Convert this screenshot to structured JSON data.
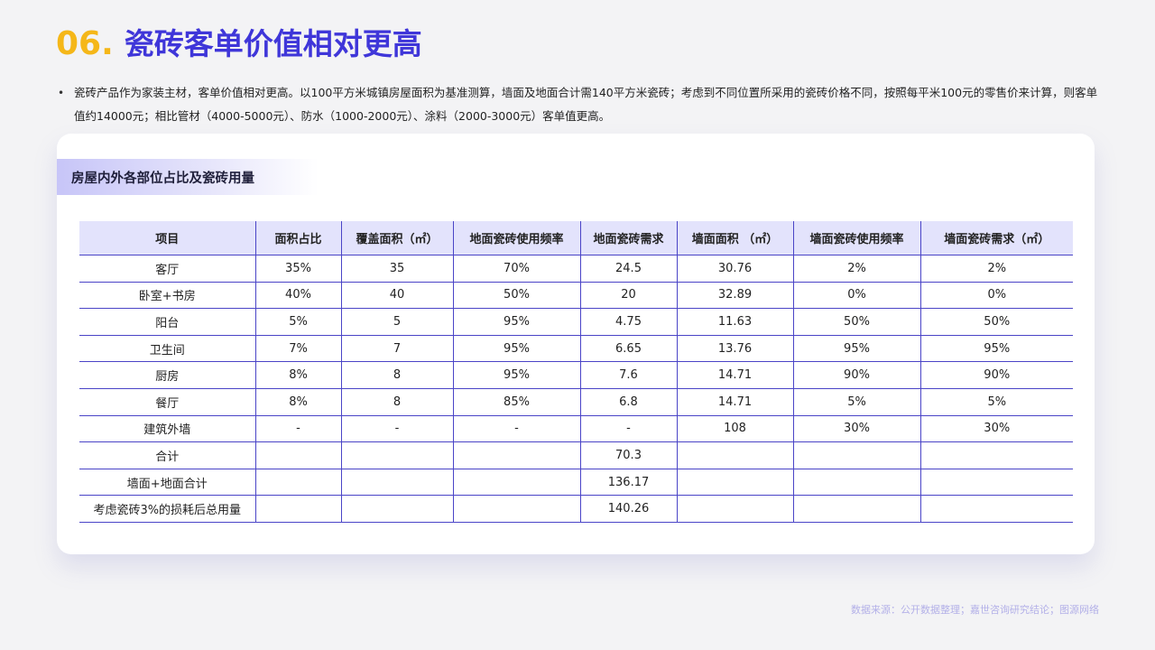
{
  "header": {
    "number": "06.",
    "title": "瓷砖客单价值相对更高"
  },
  "bullet": {
    "dot": "•",
    "text": "瓷砖产品作为家装主材，客单价值相对更高。以100平方米城镇房屋面积为基准测算，墙面及地面合计需140平方米瓷砖；考虑到不同位置所采用的瓷砖价格不同，按照每平米100元的零售价来计算，则客单值约14000元；相比管材（4000-5000元）、防水（1000-2000元）、涂料（2000-3000元）客单值更高。"
  },
  "section": {
    "label": "房屋内外各部位占比及瓷砖用量"
  },
  "table": {
    "headers": [
      "项目",
      "面积占比",
      "覆盖面积（㎡）",
      "地面瓷砖使用频率",
      "地面瓷砖需求",
      "墙面面积 （㎡）",
      "墙面瓷砖使用频率",
      "墙面瓷砖需求（㎡）"
    ],
    "rows": [
      [
        "客厅",
        "35%",
        "35",
        "70%",
        "24.5",
        "30.76",
        "2%",
        "2%"
      ],
      [
        "卧室+书房",
        "40%",
        "40",
        "50%",
        "20",
        "32.89",
        "0%",
        "0%"
      ],
      [
        "阳台",
        "5%",
        "5",
        "95%",
        "4.75",
        "11.63",
        "50%",
        "50%"
      ],
      [
        "卫生间",
        "7%",
        "7",
        "95%",
        "6.65",
        "13.76",
        "95%",
        "95%"
      ],
      [
        "厨房",
        "8%",
        "8",
        "95%",
        "7.6",
        "14.71",
        "90%",
        "90%"
      ],
      [
        "餐厅",
        "8%",
        "8",
        "85%",
        "6.8",
        "14.71",
        "5%",
        "5%"
      ],
      [
        "建筑外墙",
        "-",
        "-",
        "-",
        "-",
        "108",
        "30%",
        "30%"
      ],
      [
        "合计",
        "",
        "",
        "",
        "70.3",
        "",
        "",
        ""
      ],
      [
        "墙面+地面合计",
        "",
        "",
        "",
        "136.17",
        "",
        "",
        ""
      ],
      [
        "考虑瓷砖3%的损耗后总用量",
        "",
        "",
        "",
        "140.26",
        "",
        "",
        ""
      ]
    ]
  },
  "footer": {
    "source": "数据来源：公开数据整理；嘉世咨询研究结论；图源网络"
  },
  "colors": {
    "accent_yellow": "#f5b719",
    "accent_blue": "#3f36d9",
    "table_header_bg": "#e3e3fc",
    "table_border": "#4a44c7"
  }
}
